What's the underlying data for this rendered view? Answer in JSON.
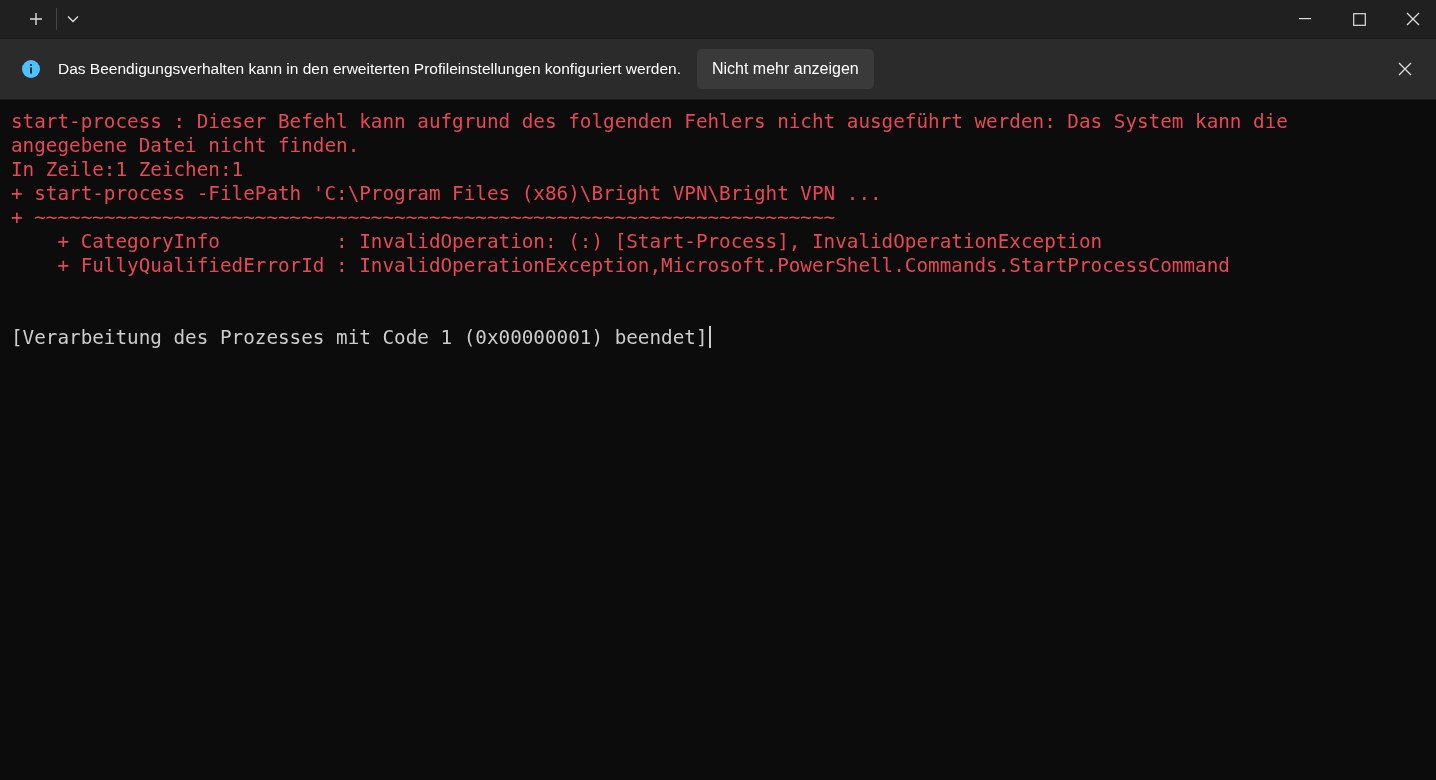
{
  "infobar": {
    "message": "Das Beendigungsverhalten kann in den erweiterten Profileinstellungen konfiguriert werden.",
    "button": "Nicht mehr anzeigen"
  },
  "terminal": {
    "lines": [
      {
        "kind": "error",
        "text": "start-process : Dieser Befehl kann aufgrund des folgenden Fehlers nicht ausgeführt werden: Das System kann die"
      },
      {
        "kind": "error",
        "text": "angegebene Datei nicht finden."
      },
      {
        "kind": "error",
        "text": "In Zeile:1 Zeichen:1"
      },
      {
        "kind": "error",
        "text": "+ start-process -FilePath 'C:\\Program Files (x86)\\Bright VPN\\Bright VPN ..."
      },
      {
        "kind": "error",
        "text": "+ ~~~~~~~~~~~~~~~~~~~~~~~~~~~~~~~~~~~~~~~~~~~~~~~~~~~~~~~~~~~~~~~~~~~~~"
      },
      {
        "kind": "error",
        "text": "    + CategoryInfo          : InvalidOperation: (:) [Start-Process], InvalidOperationException"
      },
      {
        "kind": "error",
        "text": "    + FullyQualifiedErrorId : InvalidOperationException,Microsoft.PowerShell.Commands.StartProcessCommand"
      },
      {
        "kind": "blank"
      },
      {
        "kind": "blank"
      },
      {
        "kind": "normal",
        "text": "[Verarbeitung des Prozesses mit Code 1 (0x00000001) beendet]",
        "cursor": true
      }
    ]
  }
}
